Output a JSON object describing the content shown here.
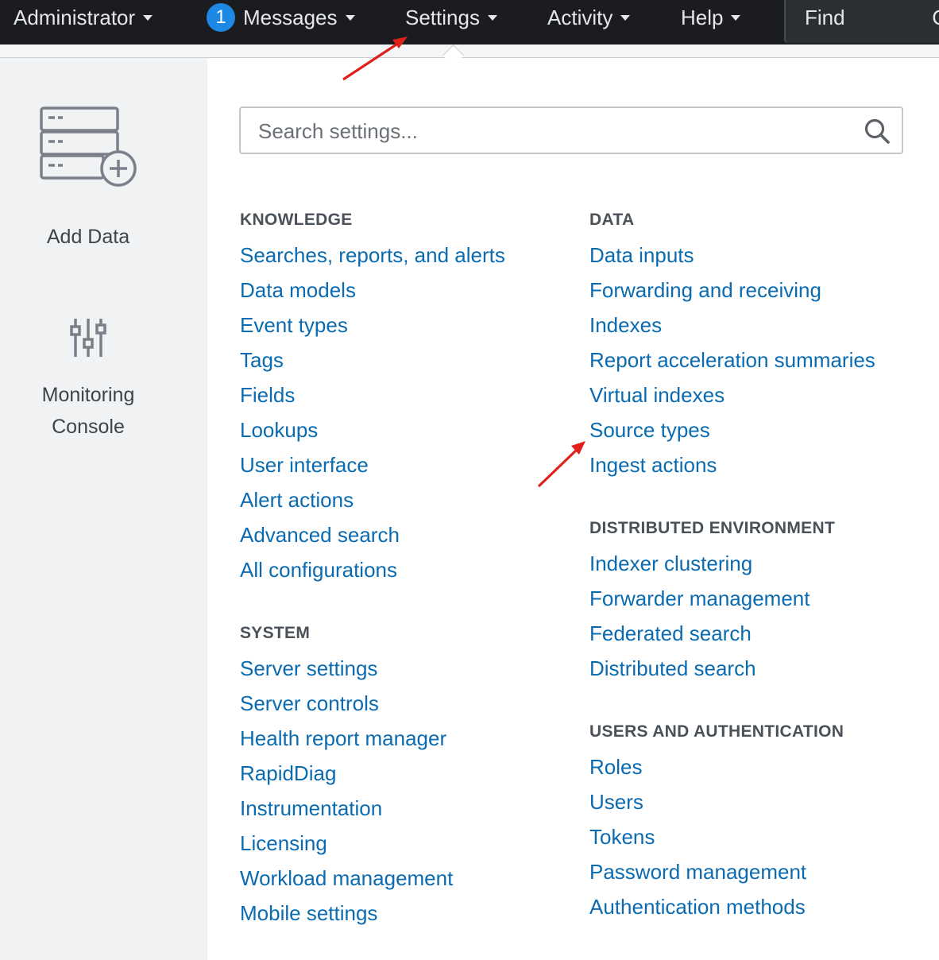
{
  "topbar": {
    "admin_label": "Administrator",
    "messages_count": "1",
    "messages_label": "Messages",
    "settings_label": "Settings",
    "activity_label": "Activity",
    "help_label": "Help",
    "find_label": "Find",
    "find_edge": "C"
  },
  "left_panel": {
    "add_data_label": "Add Data",
    "monitoring_line1": "Monitoring",
    "monitoring_line2": "Console"
  },
  "search": {
    "placeholder": "Search settings..."
  },
  "knowledge": {
    "title": "KNOWLEDGE",
    "items": [
      "Searches, reports, and alerts",
      "Data models",
      "Event types",
      "Tags",
      "Fields",
      "Lookups",
      "User interface",
      "Alert actions",
      "Advanced search",
      "All configurations"
    ]
  },
  "system": {
    "title": "SYSTEM",
    "items": [
      "Server settings",
      "Server controls",
      "Health report manager",
      "RapidDiag",
      "Instrumentation",
      "Licensing",
      "Workload management",
      "Mobile settings"
    ]
  },
  "data": {
    "title": "DATA",
    "items": [
      "Data inputs",
      "Forwarding and receiving",
      "Indexes",
      "Report acceleration summaries",
      "Virtual indexes",
      "Source types",
      "Ingest actions"
    ]
  },
  "distributed": {
    "title": "DISTRIBUTED ENVIRONMENT",
    "items": [
      "Indexer clustering",
      "Forwarder management",
      "Federated search",
      "Distributed search"
    ]
  },
  "users_auth": {
    "title": "USERS AND AUTHENTICATION",
    "items": [
      "Roles",
      "Users",
      "Tokens",
      "Password management",
      "Authentication methods"
    ]
  },
  "colors": {
    "topbar_bg": "#1a1c20",
    "link": "#0b6bb0",
    "badge": "#1e88e5",
    "annotation_arrow": "#e0201b"
  }
}
